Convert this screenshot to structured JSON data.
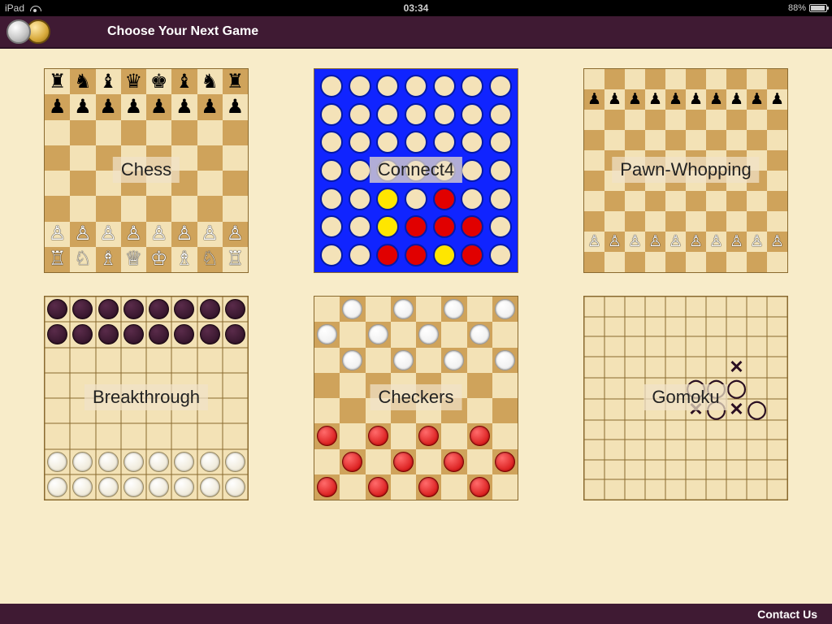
{
  "status_bar": {
    "device": "iPad",
    "time": "03:34",
    "battery_pct": "88%"
  },
  "header": {
    "title": "Choose Your Next Game"
  },
  "footer": {
    "contact": "Contact Us"
  },
  "games": {
    "chess": {
      "label": "Chess"
    },
    "connect4": {
      "label": "Connect4",
      "grid": [
        [
          "e",
          "e",
          "e",
          "e",
          "e",
          "e",
          "e"
        ],
        [
          "e",
          "e",
          "e",
          "e",
          "e",
          "e",
          "e"
        ],
        [
          "e",
          "e",
          "e",
          "e",
          "e",
          "e",
          "e"
        ],
        [
          "e",
          "e",
          "e",
          "e",
          "e",
          "e",
          "e"
        ],
        [
          "e",
          "e",
          "y",
          "e",
          "r",
          "e",
          "e"
        ],
        [
          "e",
          "e",
          "y",
          "r",
          "r",
          "r",
          "e"
        ],
        [
          "e",
          "e",
          "r",
          "r",
          "y",
          "r",
          "e"
        ]
      ]
    },
    "pawn_whopping": {
      "label": "Pawn-Whopping"
    },
    "breakthrough": {
      "label": "Breakthrough"
    },
    "checkers": {
      "label": "Checkers"
    },
    "gomoku": {
      "label": "Gomoku",
      "marks": [
        {
          "r": 3,
          "c": 7,
          "m": "X"
        },
        {
          "r": 4,
          "c": 5,
          "m": "O"
        },
        {
          "r": 4,
          "c": 6,
          "m": "O"
        },
        {
          "r": 4,
          "c": 7,
          "m": "O"
        },
        {
          "r": 5,
          "c": 5,
          "m": "X"
        },
        {
          "r": 5,
          "c": 6,
          "m": "O"
        },
        {
          "r": 5,
          "c": 7,
          "m": "X"
        },
        {
          "r": 5,
          "c": 8,
          "m": "O"
        }
      ]
    }
  },
  "chess_setup": {
    "black_back": [
      "♜",
      "♞",
      "♝",
      "♛",
      "♚",
      "♝",
      "♞",
      "♜"
    ],
    "white_back": [
      "♖",
      "♘",
      "♗",
      "♕",
      "♔",
      "♗",
      "♘",
      "♖"
    ]
  }
}
